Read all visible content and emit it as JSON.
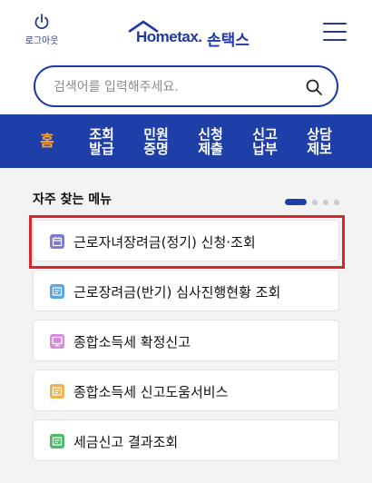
{
  "header": {
    "logout_label": "로그아웃",
    "logo_text": "Hometax.",
    "logo_suffix": "손택스",
    "brand_color": "#1f3fa8"
  },
  "search": {
    "placeholder": "검색어를 입력해주세요."
  },
  "nav": {
    "tabs": [
      {
        "label1": "홈",
        "label2": ""
      },
      {
        "label1": "조회",
        "label2": "발급"
      },
      {
        "label1": "민원",
        "label2": "증명"
      },
      {
        "label1": "신청",
        "label2": "제출"
      },
      {
        "label1": "신고",
        "label2": "납부"
      },
      {
        "label1": "상담",
        "label2": "제보"
      }
    ],
    "active_color": "#f2a23a"
  },
  "frequent": {
    "title": "자주 찾는 메뉴",
    "items": [
      {
        "label": "근로자녀장려금(정기) 신청·조회",
        "icon": "calendar-icon",
        "color": "#7b78d6"
      },
      {
        "label": "근로장려금(반기) 심사진행현황 조회",
        "icon": "document-icon",
        "color": "#5aa5e6"
      },
      {
        "label": "종합소득세 확정신고",
        "icon": "monitor-icon",
        "color": "#d98ae0"
      },
      {
        "label": "종합소득세 신고도움서비스",
        "icon": "document-icon",
        "color": "#f0b14e"
      },
      {
        "label": "세금신고 결과조회",
        "icon": "document-icon",
        "color": "#4dba6a"
      }
    ],
    "highlight_color": "#d9252c"
  }
}
